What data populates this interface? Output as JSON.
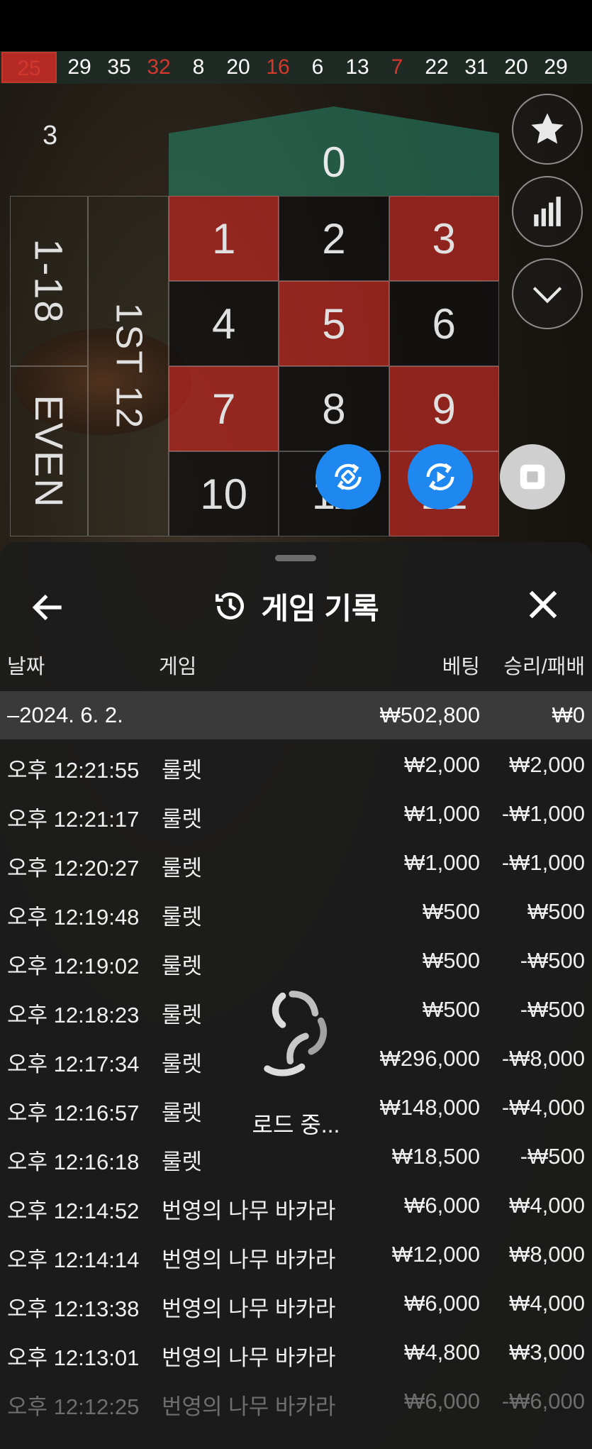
{
  "results_strip": [
    {
      "value": "25",
      "color": "red",
      "current": true
    },
    {
      "value": "29",
      "color": "black"
    },
    {
      "value": "35",
      "color": "black"
    },
    {
      "value": "32",
      "color": "red"
    },
    {
      "value": "8",
      "color": "black"
    },
    {
      "value": "20",
      "color": "black"
    },
    {
      "value": "16",
      "color": "red"
    },
    {
      "value": "6",
      "color": "black"
    },
    {
      "value": "13",
      "color": "black"
    },
    {
      "value": "7",
      "color": "red"
    },
    {
      "value": "22",
      "color": "black"
    },
    {
      "value": "31",
      "color": "black"
    },
    {
      "value": "20",
      "color": "black"
    },
    {
      "value": "29",
      "color": "black"
    }
  ],
  "game": {
    "round_number": "3",
    "zero": "0",
    "side_labels": {
      "low": "1-18",
      "even": "EVEN",
      "dozen": "1ST 12"
    },
    "cells": [
      {
        "n": "1",
        "c": "red"
      },
      {
        "n": "2",
        "c": "black"
      },
      {
        "n": "3",
        "c": "red"
      },
      {
        "n": "4",
        "c": "black"
      },
      {
        "n": "5",
        "c": "red"
      },
      {
        "n": "6",
        "c": "black"
      },
      {
        "n": "7",
        "c": "red"
      },
      {
        "n": "8",
        "c": "black"
      },
      {
        "n": "9",
        "c": "red"
      },
      {
        "n": "10",
        "c": "black"
      },
      {
        "n": "11",
        "c": "black"
      },
      {
        "n": "12",
        "c": "red"
      }
    ]
  },
  "icons": {
    "favorite": "star-icon",
    "statistics": "bar-chart-icon",
    "collapse": "chevron-down-icon",
    "repeat": "repeat-bet-icon",
    "autoplay": "autoplay-icon",
    "stop": "stop-icon",
    "history": "history-clock-icon",
    "back": "arrow-left-icon",
    "close": "close-icon"
  },
  "colors": {
    "accent_blue": "#1e88f0",
    "table_red": "#b0261f",
    "table_green": "#268c6e"
  },
  "history_panel": {
    "title": "게임 기록",
    "columns": {
      "date": "날짜",
      "game": "게임",
      "bet": "베팅",
      "result": "승리/패배"
    },
    "day_summary": {
      "date": "–2024. 6. 2.",
      "bet": "₩502,800",
      "result": "₩0"
    },
    "rows": [
      {
        "time": "오후 12:21:55",
        "game": "룰렛",
        "bet": "₩2,000",
        "result": "₩2,000"
      },
      {
        "time": "오후 12:21:17",
        "game": "룰렛",
        "bet": "₩1,000",
        "result": "-₩1,000"
      },
      {
        "time": "오후 12:20:27",
        "game": "룰렛",
        "bet": "₩1,000",
        "result": "-₩1,000"
      },
      {
        "time": "오후 12:19:48",
        "game": "룰렛",
        "bet": "₩500",
        "result": "₩500"
      },
      {
        "time": "오후 12:19:02",
        "game": "룰렛",
        "bet": "₩500",
        "result": "-₩500"
      },
      {
        "time": "오후 12:18:23",
        "game": "룰렛",
        "bet": "₩500",
        "result": "-₩500"
      },
      {
        "time": "오후 12:17:34",
        "game": "룰렛",
        "bet": "₩296,000",
        "result": "-₩8,000"
      },
      {
        "time": "오후 12:16:57",
        "game": "룰렛",
        "bet": "₩148,000",
        "result": "-₩4,000"
      },
      {
        "time": "오후 12:16:18",
        "game": "룰렛",
        "bet": "₩18,500",
        "result": "-₩500"
      },
      {
        "time": "오후 12:14:52",
        "game": "번영의 나무 바카라",
        "bet": "₩6,000",
        "result": "₩4,000"
      },
      {
        "time": "오후 12:14:14",
        "game": "번영의 나무 바카라",
        "bet": "₩12,000",
        "result": "₩8,000"
      },
      {
        "time": "오후 12:13:38",
        "game": "번영의 나무 바카라",
        "bet": "₩6,000",
        "result": "₩4,000"
      },
      {
        "time": "오후 12:13:01",
        "game": "번영의 나무 바카라",
        "bet": "₩4,800",
        "result": "₩3,000"
      },
      {
        "time": "오후 12:12:25",
        "game": "번영의 나무 바카라",
        "bet": "₩6,000",
        "result": "-₩6,000",
        "faded": true
      }
    ],
    "loading_text": "로드 중..."
  }
}
